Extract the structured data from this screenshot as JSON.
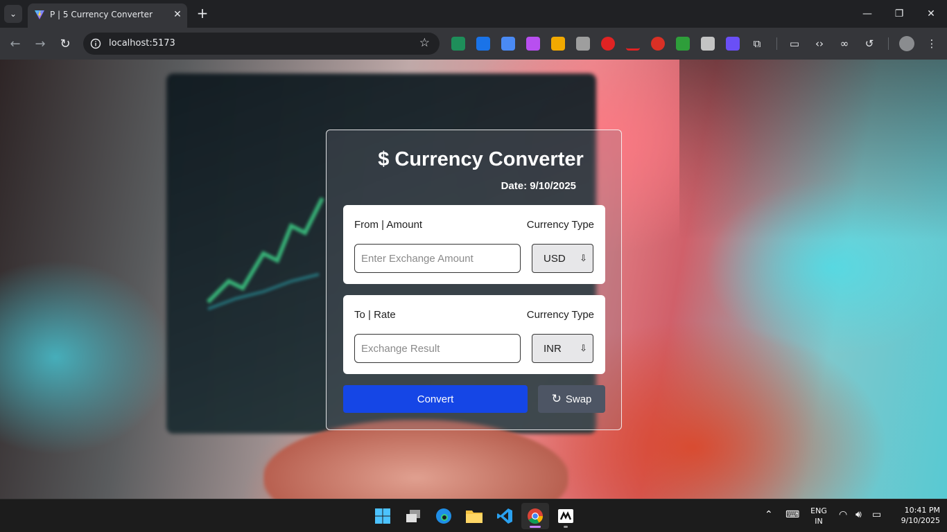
{
  "browser": {
    "tab_title": "P | 5 Currency Converter",
    "url": "localhost:5173"
  },
  "app": {
    "title": "$ Currency Converter",
    "date": "Date: 9/10/2025",
    "from": {
      "label": "From | Amount",
      "type_label": "Currency Type",
      "placeholder": "Enter Exchange Amount",
      "currency": "USD"
    },
    "to": {
      "label": "To | Rate",
      "type_label": "Currency Type",
      "placeholder": "Exchange Result",
      "currency": "INR"
    },
    "convert_label": "Convert",
    "swap_label": "Swap",
    "colors": {
      "convert": "#1546e6",
      "swap": "#4d5564"
    }
  },
  "taskbar": {
    "lang_primary": "ENG",
    "lang_secondary": "IN",
    "time": "10:41 PM",
    "date": "9/10/2025"
  }
}
